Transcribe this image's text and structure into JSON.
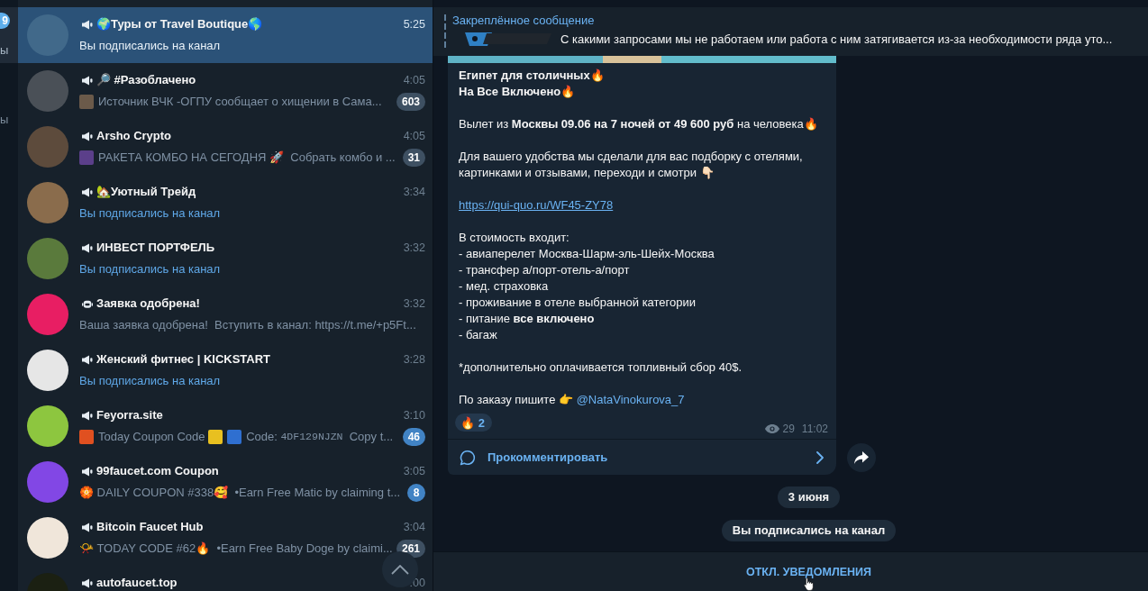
{
  "folders": [
    {
      "label": "ы",
      "badge": "9",
      "selected": true
    },
    {
      "label": "ы",
      "selected": false
    }
  ],
  "chats": [
    {
      "kind": "channel",
      "title": "🌍Туры от Travel Boutique🌎",
      "time": "5:25",
      "selected": true,
      "avatar": {
        "color": "#41698a"
      },
      "preview": [
        {
          "kind": "service",
          "text": "Вы подписались на канал"
        }
      ]
    },
    {
      "kind": "channel",
      "title": "🔎 #Разоблачено",
      "time": "4:05",
      "selected": false,
      "avatar": {
        "color": "#4a5057"
      },
      "preview": [
        {
          "kind": "thumb",
          "color": "#6b5a4a"
        },
        {
          "kind": "text",
          "text": "Источник ВЧК -ОГПУ сообщает о хищении в Сама..."
        }
      ],
      "badge": "603",
      "muted": true
    },
    {
      "kind": "channel",
      "title": "Arsho Crypto",
      "time": "4:05",
      "selected": false,
      "avatar": {
        "color": "#5d4b3c"
      },
      "preview": [
        {
          "kind": "thumb",
          "color": "#5b3f8a"
        },
        {
          "kind": "text",
          "text": "РАКЕТА КОМБО НА СЕГОДНЯ 🚀  Собрать комбо и ..."
        }
      ],
      "badge": "31",
      "muted": true
    },
    {
      "kind": "channel",
      "title": "🏡Уютный Трейд",
      "time": "3:34",
      "selected": false,
      "avatar": {
        "color": "#8a6c4c"
      },
      "preview": [
        {
          "kind": "service",
          "text": "Вы подписались на канал"
        }
      ]
    },
    {
      "kind": "channel",
      "title": "ИНВЕСТ ПОРТФЕЛЬ",
      "time": "3:32",
      "selected": false,
      "avatar": {
        "color": "#5a7a3c"
      },
      "preview": [
        {
          "kind": "service",
          "text": "Вы подписались на канал"
        }
      ]
    },
    {
      "kind": "bot",
      "title": "Заявка одобрена!",
      "time": "3:32",
      "selected": false,
      "avatar": {
        "color": "#e81e63"
      },
      "preview": [
        {
          "kind": "text",
          "text": "Ваша заявка одобрена!  Вступить в канал: https://t.me/+p5Ft..."
        }
      ]
    },
    {
      "kind": "channel",
      "title": "Женский фитнес | KICKSTART",
      "time": "3:28",
      "selected": false,
      "avatar": {
        "color": "#e6e6e6"
      },
      "preview": [
        {
          "kind": "service",
          "text": "Вы подписались на канал"
        }
      ]
    },
    {
      "kind": "channel",
      "title": "Feyorra.site",
      "time": "3:10",
      "selected": false,
      "avatar": {
        "color": "#8dc63f"
      },
      "preview": [
        {
          "kind": "thumb",
          "color": "#e05020"
        },
        {
          "kind": "text",
          "text": "Today Coupon Code "
        },
        {
          "kind": "thumb",
          "color": "#e8c020"
        },
        {
          "kind": "thumb",
          "color": "#2f6fd0"
        },
        {
          "kind": "text",
          "text": "Code: "
        },
        {
          "kind": "code",
          "text": "4DF129NJZN"
        },
        {
          "kind": "text",
          "text": "  Copy t..."
        }
      ],
      "badge": "46",
      "muted": false
    },
    {
      "kind": "channel",
      "title": "99faucet.com Coupon",
      "time": "3:05",
      "selected": false,
      "avatar": {
        "color": "#8247e5"
      },
      "preview": [
        {
          "kind": "text",
          "text": "🏵️ DAILY COUPON #338🥰  •Earn Free Matic by claiming t..."
        }
      ],
      "badge": "8",
      "muted": false
    },
    {
      "kind": "channel",
      "title": "Bitcoin Faucet Hub",
      "time": "3:04",
      "selected": false,
      "avatar": {
        "color": "#f0e6da"
      },
      "preview": [
        {
          "kind": "text",
          "text": "📯 TODAY CODE #62🔥  •Earn Free Baby Doge by claimi..."
        }
      ],
      "badge": "261",
      "muted": true
    },
    {
      "kind": "channel",
      "title": "autofaucet.top",
      "time": ":00",
      "selected": false,
      "avatar": {
        "color": "#1b2012"
      }
    }
  ],
  "pinned": {
    "title": "Закреплённое сообщение",
    "text": "С какими запросами мы не работаем или работа с ним затягивается из-за необходимости ряда уто..."
  },
  "message": {
    "paragraphs": [
      {
        "lines": [
          {
            "kind": "bold",
            "text": "Египет для столичных🔥"
          },
          {
            "kind": "bold",
            "text": "На Все Включено🔥"
          }
        ]
      },
      {
        "lines": [
          {
            "kind": "rich",
            "text": "Вылет из **Москвы 09.06 на 7 ночей от 49 600 руб** на человека🔥"
          }
        ]
      },
      {
        "lines": [
          {
            "kind": "plain",
            "text": "Для вашего удобства мы сделали для вас подборку с отелями, картинками и отзывами, переходи и смотри 👇🏻"
          }
        ]
      },
      {
        "lines": [
          {
            "kind": "link",
            "text": "https://qui-quo.ru/WF45-ZY78"
          }
        ]
      },
      {
        "lines": [
          {
            "kind": "plain",
            "text": "В стоимость входит:"
          },
          {
            "kind": "plain",
            "text": "- авиаперелет Москва-Шарм-эль-Шейх-Москва"
          },
          {
            "kind": "plain",
            "text": "- трансфер а/порт-отель-а/порт"
          },
          {
            "kind": "plain",
            "text": "- мед. страховка"
          },
          {
            "kind": "plain",
            "text": "- проживание в отеле выбранной категории"
          },
          {
            "kind": "rich",
            "text": "- питание **все включено**"
          },
          {
            "kind": "plain",
            "text": "- багаж"
          }
        ]
      },
      {
        "lines": [
          {
            "kind": "plain",
            "text": "*дополнительно оплачивается топливный сбор 40$."
          }
        ]
      },
      {
        "lines": [
          {
            "kind": "mention",
            "text": "По заказу пишите 👉",
            "link": "@NataVinokurova_7"
          }
        ]
      }
    ],
    "reactions": [
      {
        "emoji": "🔥",
        "count": "2"
      }
    ],
    "views": "29",
    "time": "11:02",
    "comment": "Прокомментировать"
  },
  "date_label": "3 июня",
  "service_message": "Вы подписались на канал",
  "bottom_bar": {
    "button": "ОТКЛ. УВЕДОМЛЕНИЯ"
  }
}
